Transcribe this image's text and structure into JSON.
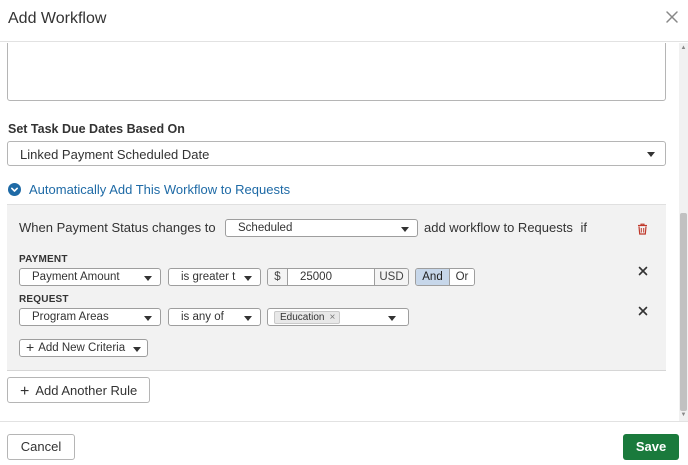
{
  "dialog": {
    "title": "Add Workflow",
    "close_icon": "close-icon"
  },
  "due_dates": {
    "label": "Set Task Due Dates Based On",
    "selected": "Linked Payment Scheduled Date"
  },
  "auto_add": {
    "label": "Automatically Add This Workflow to Requests",
    "icon": "chevron-down-circle-icon",
    "accent_color": "#1e6aa6"
  },
  "rule": {
    "prefix": "When Payment Status changes to",
    "status_selected": "Scheduled",
    "suffix": "add workflow to Requests",
    "if_text": "if",
    "delete_icon": "trash-icon",
    "criteria": [
      {
        "section": "PAYMENT",
        "field": "Payment Amount",
        "operator": "is greater t",
        "currency_prefix": "$",
        "value": "25000",
        "currency_suffix": "USD",
        "and_label": "And",
        "or_label": "Or",
        "conjunction_selected": "And"
      },
      {
        "section": "REQUEST",
        "field": "Program Areas",
        "operator": "is any of",
        "tags": [
          "Education"
        ]
      }
    ],
    "add_criteria_label": "Add New Criteria"
  },
  "add_rule_label": "Add Another Rule",
  "footer": {
    "cancel_label": "Cancel",
    "save_label": "Save",
    "save_color": "#1a7a3c"
  }
}
